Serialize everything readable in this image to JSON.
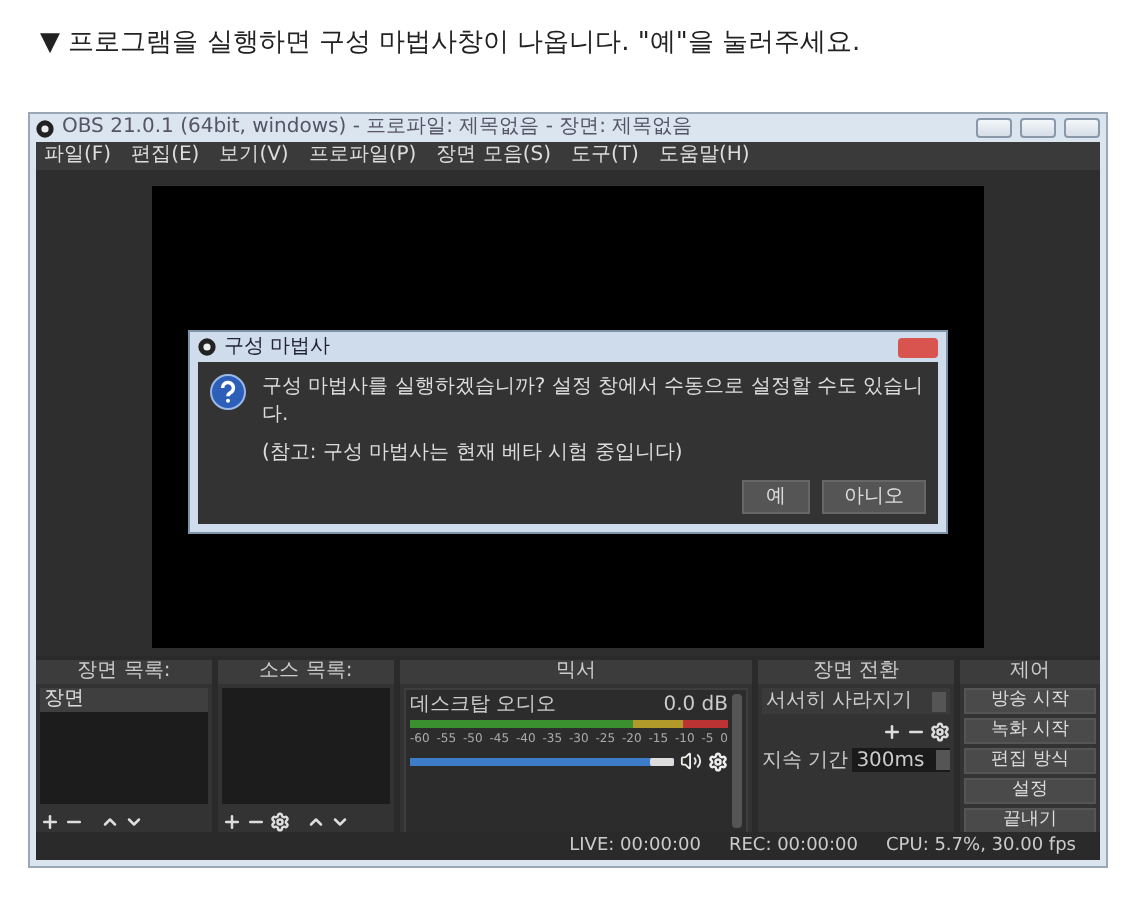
{
  "heading": "▼ 프로그램을 실행하면 구성 마법사창이 나옵니다. \"예\"을 눌러주세요.",
  "window": {
    "title": "OBS 21.0.1 (64bit, windows) - 프로파일: 제목없음 - 장면: 제목없음"
  },
  "menu": [
    "파일(F)",
    "편집(E)",
    "보기(V)",
    "프로파일(P)",
    "장면 모음(S)",
    "도구(T)",
    "도움말(H)"
  ],
  "dialog": {
    "title": "구성 마법사",
    "message": "구성 마법사를 실행하겠습니까? 설정 창에서 수동으로 설정할 수도 있습니다.",
    "note": "(참고: 구성 마법사는 현재 베타 시험 중입니다)",
    "buttons": [
      "예",
      "아니오"
    ]
  },
  "scenes": {
    "title": "장면 목록:",
    "items": [
      {
        "label": "장면",
        "selected": true
      }
    ]
  },
  "sources": {
    "title": "소스 목록:"
  },
  "mixer": {
    "title": "믹서",
    "ticks": [
      "-60",
      "-55",
      "-50",
      "-45",
      "-40",
      "-35",
      "-30",
      "-25",
      "-20",
      "-15",
      "-10",
      "-5",
      "0"
    ],
    "channels": [
      {
        "name": "데스크탑 오디오",
        "reading": "0.0 dB",
        "level": 1,
        "muted": false
      }
    ]
  },
  "transitions": {
    "title": "장면 전환",
    "transition": "서서히 사라지기",
    "duration_label": "지속 기간",
    "duration": "300ms"
  },
  "controls": {
    "title": "제어",
    "buttons": [
      "방송 시작",
      "녹화 시작",
      "편집 방식",
      "설정",
      "끝내기"
    ]
  },
  "status_bar": [
    "LIVE: 00:00:00",
    "REC: 00:00:00",
    "CPU: 5.7%, 30.00 fps"
  ]
}
